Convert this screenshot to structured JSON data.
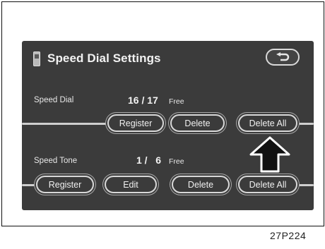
{
  "screen": {
    "title": "Speed Dial Settings",
    "back_icon": "return-arrow-icon",
    "phone_icon": "phone-icon"
  },
  "speed_dial": {
    "label": "Speed Dial",
    "count": "16 / 17",
    "free": "Free",
    "buttons": {
      "register": "Register",
      "delete": "Delete",
      "delete_all": "Delete All"
    }
  },
  "speed_tone": {
    "label": "Speed Tone",
    "count": "1 /   6",
    "free": "Free",
    "buttons": {
      "register": "Register",
      "edit": "Edit",
      "delete": "Delete",
      "delete_all": "Delete All"
    }
  },
  "pointer": "up-arrow-indicator",
  "caption": "27P224",
  "colors": {
    "screen_bg": "#3b3b3b",
    "button_border": "#d8d8d8",
    "text": "#f0f0f0"
  }
}
